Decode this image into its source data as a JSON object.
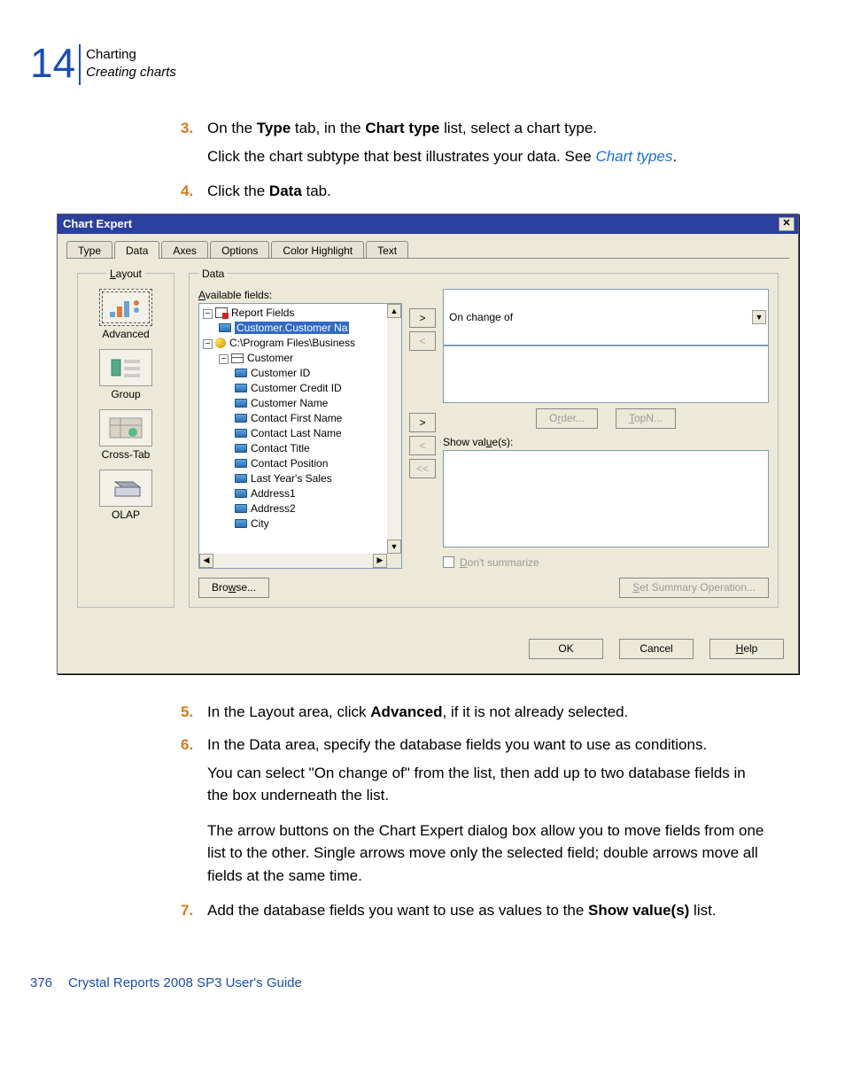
{
  "header": {
    "chapter_number": "14",
    "title_line1": "Charting",
    "title_line2": "Creating charts"
  },
  "steps": [
    {
      "num": "3.",
      "type": "compound",
      "line1_pre": "On the ",
      "b1": "Type",
      "mid1": " tab, in the ",
      "b2": "Chart type",
      "mid2": " list, select a chart type.",
      "p_pre": "Click the chart subtype that best illustrates your data. See ",
      "p_link": "Chart types",
      "p_post": "."
    },
    {
      "num": "4.",
      "type": "simple",
      "pre": "Click the ",
      "b1": "Data",
      "post": " tab."
    }
  ],
  "dialog": {
    "title": "Chart Expert",
    "tabs": {
      "type": "Type",
      "data": "Data",
      "axes": "Axes",
      "options": "Options",
      "color": "Color Highlight",
      "text": "Text"
    },
    "layout": {
      "legend": "Layout",
      "advanced": "Advanced",
      "group": "Group",
      "crosstab": "Cross-Tab",
      "olap": "OLAP"
    },
    "data": {
      "legend": "Data",
      "available_label": "Available fields:",
      "tree": {
        "report_fields": "Report Fields",
        "cust_name_full": "Customer.Customer Na",
        "path": "C:\\Program Files\\Business",
        "customer": "Customer",
        "fields": [
          "Customer ID",
          "Customer Credit ID",
          "Customer Name",
          "Contact First Name",
          "Contact Last Name",
          "Contact Title",
          "Contact Position",
          "Last Year's Sales",
          "Address1",
          "Address2",
          "City"
        ]
      },
      "move": {
        "r1": ">",
        "l1": "<",
        "r2": ">",
        "l2": "<",
        "ll": "<<"
      },
      "on_change_label": "On change of",
      "order_btn": "Order...",
      "topn_btn": "TopN...",
      "show_values_label": "Show value(s):",
      "dont_summarize": "Don't summarize",
      "browse_btn": "Browse...",
      "set_summary_btn": "Set Summary Operation..."
    },
    "footer": {
      "ok": "OK",
      "cancel": "Cancel",
      "help": "Help"
    }
  },
  "steps_after": [
    {
      "num": "5.",
      "type": "simple2",
      "pre": "In the Layout area, click ",
      "b1": "Advanced",
      "post": ", if it is not already selected."
    },
    {
      "num": "6.",
      "type": "para",
      "line": "In the Data area, specify the database fields you want to use as conditions.",
      "p1": "You can select \"On change of\" from the list, then add up to two database fields in the box underneath the list.",
      "p2": "The arrow buttons on the Chart Expert dialog box allow you to move fields from one list to the other. Single arrows move only the selected field; double arrows move all fields at the same time."
    },
    {
      "num": "7.",
      "type": "simple3",
      "pre": "Add the database fields you want to use as values to the ",
      "b1": "Show value(s)",
      "post": " list."
    }
  ],
  "page_footer": {
    "page": "376",
    "title": "Crystal Reports 2008 SP3 User's Guide"
  }
}
